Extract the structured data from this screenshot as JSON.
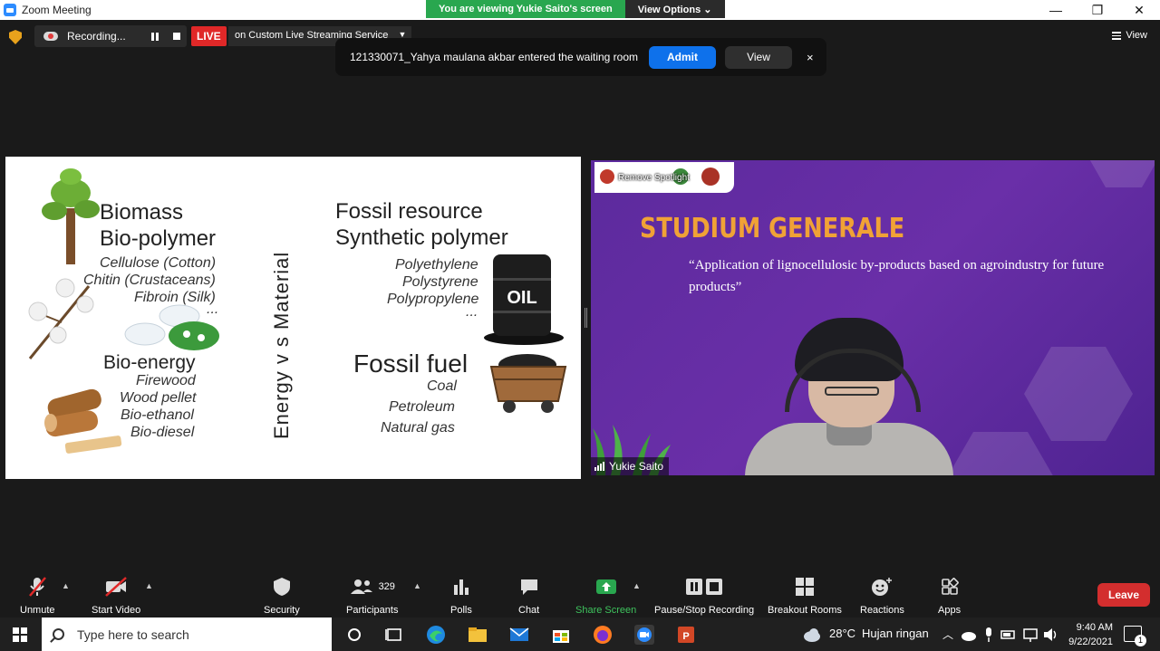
{
  "window": {
    "title": "Zoom Meeting"
  },
  "banner": {
    "viewing_text": "You are viewing Yukie Saito's screen",
    "view_options_label": "View Options"
  },
  "window_controls": {
    "minimize": "—",
    "maximize": "❐",
    "close": "✕"
  },
  "recording": {
    "label": "Recording..."
  },
  "live": {
    "badge": "LIVE",
    "service": "on Custom Live Streaming Service"
  },
  "view_menu": {
    "label": "View"
  },
  "waiting_room": {
    "message": "121330071_Yahya maulana akbar entered the waiting room",
    "admit_label": "Admit",
    "view_label": "View",
    "close": "×"
  },
  "slide": {
    "biomass": "Biomass",
    "bio_polymer": "Bio-polymer",
    "bio_polymer_items": [
      "Cellulose (Cotton)",
      "Chitin (Crustaceans)",
      "Fibroin (Silk)",
      "..."
    ],
    "bio_energy": "Bio-energy",
    "bio_energy_items": [
      "Firewood",
      "Wood pellet",
      "Bio-ethanol",
      "Bio-diesel"
    ],
    "vertical_label": "Energy  v s  Material",
    "fossil_resource": "Fossil resource",
    "synthetic_polymer": "Synthetic polymer",
    "synthetic_items": [
      "Polyethylene",
      "Polystyrene",
      "Polypropylene",
      "..."
    ],
    "oil_label": "OIL",
    "fossil_fuel": "Fossil fuel",
    "fossil_fuel_items": [
      "Coal",
      "Petroleum",
      "Natural gas"
    ]
  },
  "video": {
    "spotlight_label": "Remove Spotlight",
    "banner_title": "STUDIUM GENERALE",
    "banner_quote": "“Application of lignocellulosic by-products based on agroindustry for future products”",
    "participant_name": "Yukie Saito"
  },
  "toolbar": {
    "unmute": "Unmute",
    "start_video": "Start Video",
    "security": "Security",
    "participants": "Participants",
    "participants_count": "329",
    "polls": "Polls",
    "chat": "Chat",
    "share_screen": "Share Screen",
    "pause_stop_recording": "Pause/Stop Recording",
    "breakout_rooms": "Breakout Rooms",
    "reactions": "Reactions",
    "apps": "Apps",
    "leave": "Leave"
  },
  "taskbar": {
    "search_placeholder": "Type here to search",
    "weather_temp": "28°C",
    "weather_desc": "Hujan ringan",
    "time": "9:40 AM",
    "date": "9/22/2021",
    "notification_count": "1"
  },
  "colors": {
    "zoom_blue": "#0e71eb",
    "live_red": "#e02828",
    "share_green": "#29a74f",
    "leave_red": "#d32e2e",
    "video_purple": "#5c2a9d",
    "banner_orange": "#f0a236"
  }
}
